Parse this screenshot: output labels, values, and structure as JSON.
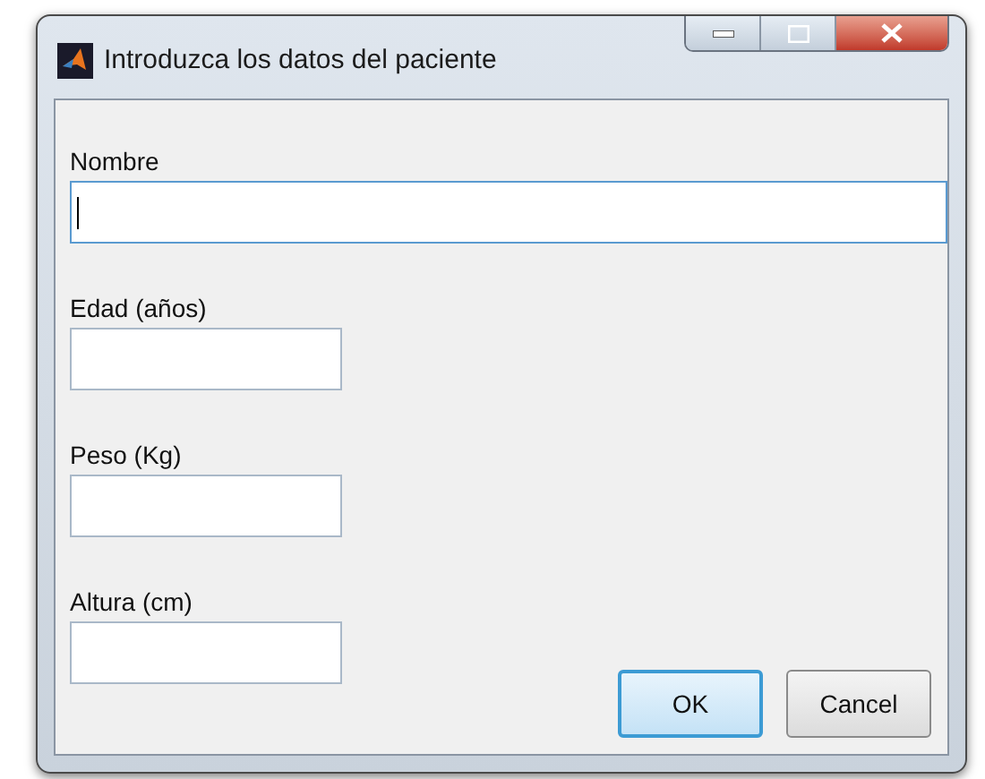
{
  "window": {
    "title": "Introduzca los datos del paciente"
  },
  "fields": [
    {
      "label": "Nombre",
      "wide": true,
      "focused": true
    },
    {
      "label": "Edad (años)",
      "wide": false,
      "focused": false
    },
    {
      "label": "Peso (Kg)",
      "wide": false,
      "focused": false
    },
    {
      "label": "Altura (cm)",
      "wide": false,
      "focused": false
    }
  ],
  "buttons": [
    {
      "label": "OK",
      "default": true
    },
    {
      "label": "Cancel",
      "default": false
    }
  ]
}
